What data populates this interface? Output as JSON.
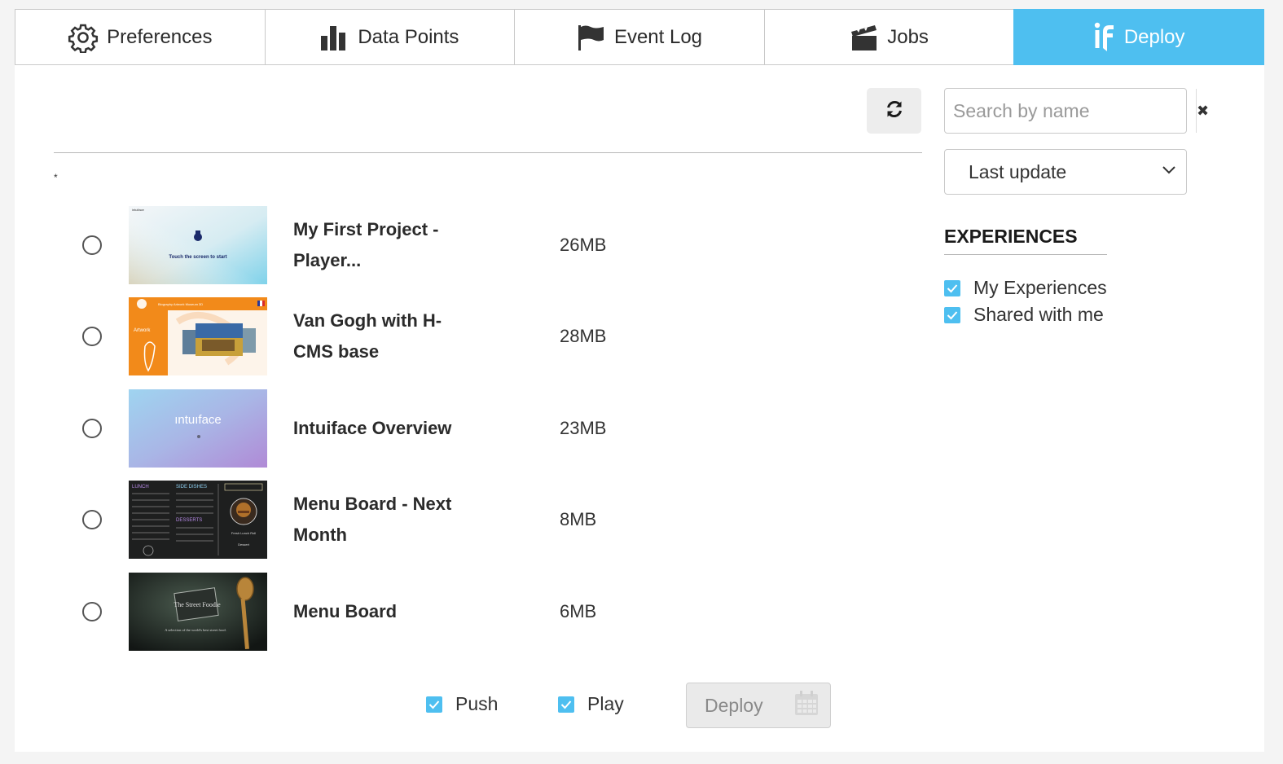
{
  "tabs": [
    {
      "label": "Preferences",
      "icon": "gear-icon"
    },
    {
      "label": "Data Points",
      "icon": "bar-chart-icon"
    },
    {
      "label": "Event Log",
      "icon": "flag-icon"
    },
    {
      "label": "Jobs",
      "icon": "clapperboard-icon"
    },
    {
      "label": "Deploy",
      "icon": "intuiface-logo-icon",
      "active": true
    }
  ],
  "toolbar": {
    "refresh_icon": "refresh-icon",
    "asterisk": "*"
  },
  "search": {
    "placeholder": "Search by name",
    "value": "",
    "clear_symbol": "✖"
  },
  "sort": {
    "selected": "Last update"
  },
  "experiences": {
    "title": "EXPERIENCES",
    "filters": [
      {
        "label": "My Experiences",
        "checked": true
      },
      {
        "label": "Shared with me",
        "checked": true
      }
    ]
  },
  "items": [
    {
      "name": "My First Project - Player...",
      "size": "26MB",
      "thumb_text": "Touch the screen to start"
    },
    {
      "name": "Van Gogh with H-CMS base",
      "size": "28MB",
      "thumb_text": "Artwork"
    },
    {
      "name": "Intuiface Overview",
      "size": "23MB",
      "thumb_text": "ıntuıface"
    },
    {
      "name": "Menu Board - Next Month",
      "size": "8MB",
      "thumb_text": "LUNCH"
    },
    {
      "name": "Menu Board",
      "size": "6MB",
      "thumb_text": "The Street Foodie"
    }
  ],
  "footer": {
    "push_label": "Push",
    "play_label": "Play",
    "deploy_label": "Deploy"
  },
  "colors": {
    "accent": "#4ebff0"
  }
}
